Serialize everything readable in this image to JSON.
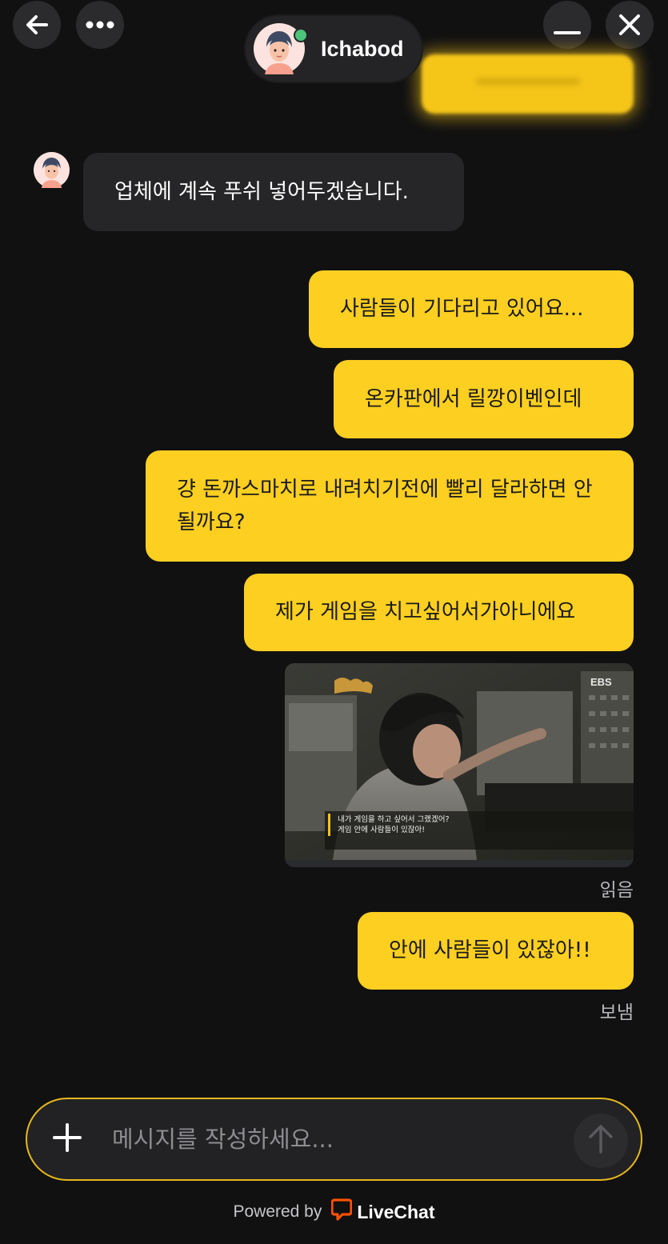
{
  "header": {
    "back_icon": "arrow-left-icon",
    "more_icon": "more-horizontal-icon",
    "minimize_icon": "minimize-icon",
    "close_icon": "close-icon",
    "agent_name": "Ichabod",
    "agent_status": "online",
    "status_color": "#4cc47b"
  },
  "messages": [
    {
      "from": "agent",
      "text": "업체에 계속 푸쉬 넣어두겠습니다."
    },
    {
      "from": "visitor",
      "text": "사람들이 기다리고 있어요..."
    },
    {
      "from": "visitor",
      "text": "온카판에서 릴깡이벤인데"
    },
    {
      "from": "visitor",
      "text": "걍 돈까스마치로 내려치기전에 빨리 달라하면 안될까요?"
    },
    {
      "from": "visitor",
      "text": "제가 게임을 치고싶어서가아니에요"
    },
    {
      "from": "visitor",
      "type": "image",
      "image": {
        "logo_text": "EBS",
        "caption_line1": "내가 게임을 하고 싶어서 그랬겠어?",
        "caption_line2": "게임 안에 사람들이 있잖아!"
      }
    },
    {
      "from": "visitor",
      "text": "안에 사람들이 있잖아!!"
    }
  ],
  "receipts": {
    "read": "읽음",
    "sent": "보냄"
  },
  "composer": {
    "placeholder": "메시지를 작성하세요...",
    "add_icon": "plus-icon",
    "send_icon": "arrow-up-icon"
  },
  "footer": {
    "powered_by": "Powered by",
    "brand": "LiveChat",
    "brand_color": "#ff5100"
  },
  "colors": {
    "background": "#111112",
    "visitor_bubble": "#fccf21",
    "agent_bubble": "#262628",
    "composer_border": "#e6b81d"
  }
}
